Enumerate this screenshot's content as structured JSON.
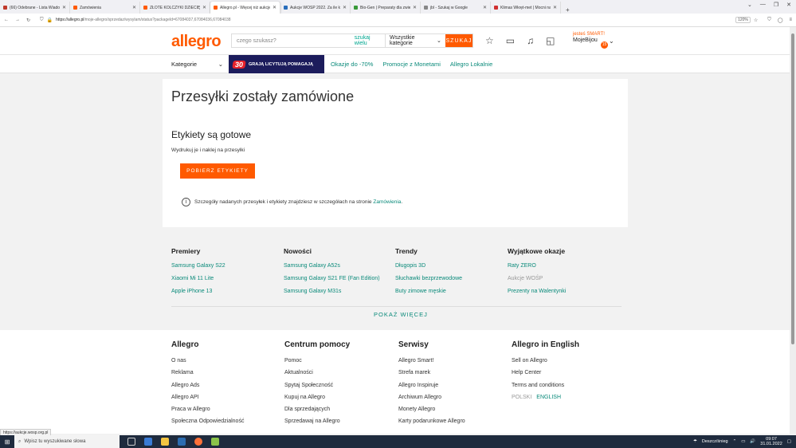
{
  "browser": {
    "tabs": [
      {
        "title": "(66) Odebrane - Lista Wiadomości",
        "color": "#c0392b",
        "active": false
      },
      {
        "title": "Zamówienia",
        "color": "#ff5a00",
        "active": false
      },
      {
        "title": "ZŁOTE KOLCZYKI DZIECIĘCE PR",
        "color": "#ff5a00",
        "active": false
      },
      {
        "title": "Allegro.pl - Więcej niż aukcje. N",
        "color": "#ff5a00",
        "active": true
      },
      {
        "title": "Aukcje WOŚP 2022. Za ile kupi",
        "color": "#2a6ebb",
        "active": false
      },
      {
        "title": "Bio-Gen | Preparaty dla zwierząt",
        "color": "#3a9a3a",
        "active": false
      },
      {
        "title": "jbl - Szukaj w Google",
        "color": "#888888",
        "active": false
      },
      {
        "title": "Klimas Wkręt-met | Mocni na pl",
        "color": "#d03030",
        "active": false
      }
    ],
    "url_host": "https://allegro.pl",
    "url_path": "/moje-allegro/sprzedaz/wysylam/status?packageId=67084037,67084036,67084038",
    "zoom": "120%",
    "status_url": "https://aukcje.wosp.org.pl"
  },
  "header": {
    "logo": "allegro",
    "search_placeholder": "czego szukasz?",
    "search_scope": "szukaj wielu",
    "category": "Wszystkie kategorie",
    "search_button": "SZUKAJ",
    "user_line1": "jesteś SMART!",
    "user_name": "MojeBijou",
    "user_badge": "15"
  },
  "catbar": {
    "categories": "Kategorie",
    "promo_badge": "30",
    "promo_text": "GRAJĄ LICYTUJĄ POMAGAJĄ",
    "links": [
      "Okazje do -70%",
      "Promocje z Monetami",
      "Allegro Lokalnie"
    ]
  },
  "card": {
    "title": "Przesyłki zostały zamówione",
    "subtitle": "Etykiety są gotowe",
    "description": "Wydrukuj je i naklej na przesyłki",
    "button": "POBIERZ ETYKIETY",
    "info_text": "Szczegóły nadanych przesyłek i etykiety znajdziesz w szczegółach na stronie",
    "info_link": "Zamówienia",
    "info_end": "."
  },
  "recommendations": [
    {
      "heading": "Premiery",
      "links": [
        "Samsung Galaxy S22",
        "Xiaomi Mi 11 Lite",
        "Apple iPhone 13"
      ]
    },
    {
      "heading": "Nowości",
      "links": [
        "Samsung Galaxy A52s",
        "Samsung Galaxy S21 FE (Fan Edition)",
        "Samsung Galaxy M31s"
      ]
    },
    {
      "heading": "Trendy",
      "links": [
        "Długopis 3D",
        "Słuchawki bezprzewodowe",
        "Buty zimowe męskie"
      ]
    },
    {
      "heading": "Wyjątkowe okazje",
      "links": [
        "Raty ZERO",
        "Aukcje WOŚP",
        "Prezenty na Walentynki"
      ]
    }
  ],
  "show_more": "POKAŻ WIĘCEJ",
  "footer": [
    {
      "heading": "Allegro",
      "links": [
        "O nas",
        "Reklama",
        "Allegro Ads",
        "Allegro API",
        "Praca w Allegro",
        "Społeczna Odpowiedzialność"
      ]
    },
    {
      "heading": "Centrum pomocy",
      "links": [
        "Pomoc",
        "Aktualności",
        "Spytaj Społeczność",
        "Kupuj na Allegro",
        "Dla sprzedających",
        "Sprzedawaj na Allegro"
      ]
    },
    {
      "heading": "Serwisy",
      "links": [
        "Allegro Smart!",
        "Strefa marek",
        "Allegro Inspiruje",
        "Archiwum Allegro",
        "Monety Allegro",
        "Karty podarunkowe Allegro"
      ]
    },
    {
      "heading": "Allegro in English",
      "links": [
        "Sell on Allegro",
        "Help Center",
        "Terms and conditions"
      ],
      "lang_off": "POLSKI",
      "lang_on": "ENGLISH"
    }
  ],
  "taskbar": {
    "search_placeholder": "Wpisz tu wyszukiwane słowa",
    "weather": "Deszcz/śnieg",
    "time": "09:07",
    "date": "31.01.2022"
  }
}
